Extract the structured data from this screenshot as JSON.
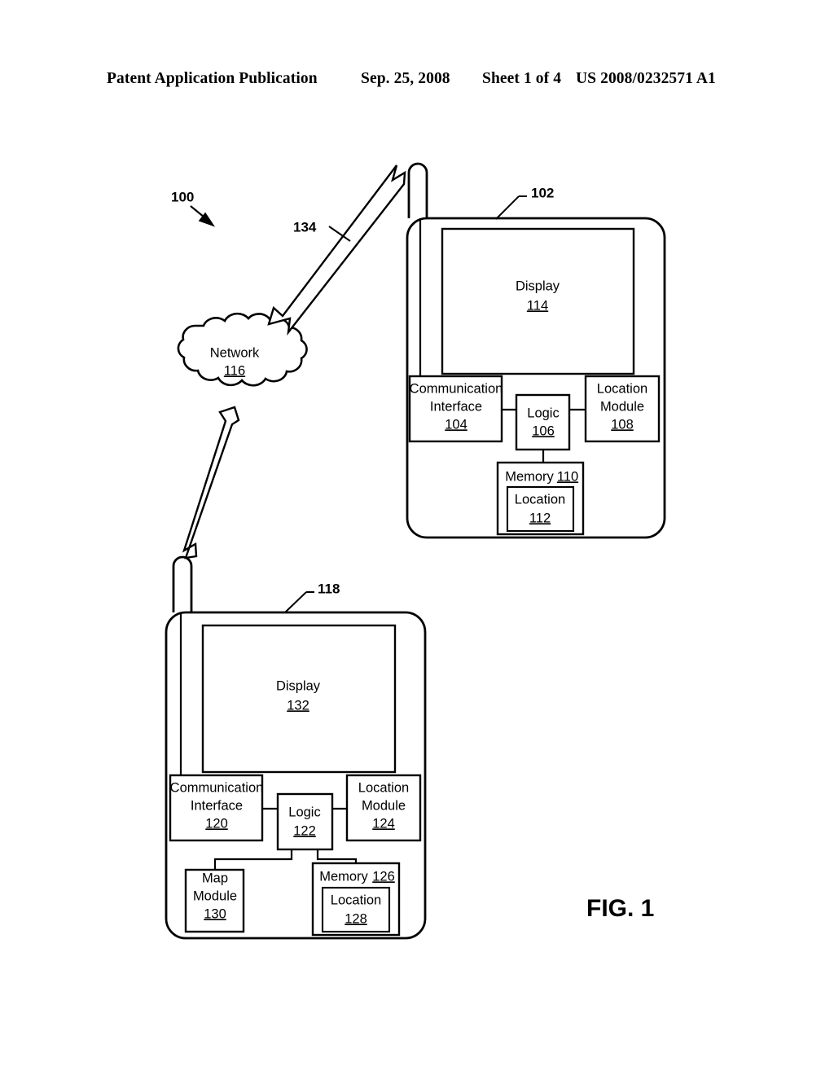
{
  "header": {
    "publication": "Patent Application Publication",
    "date": "Sep. 25, 2008",
    "sheet": "Sheet 1 of 4",
    "patent_number": "US 2008/0232571 A1"
  },
  "figure": {
    "label": "FIG. 1",
    "system_ref": "100",
    "link_ref": "134",
    "network": {
      "name": "Network",
      "ref": "116"
    },
    "device_top": {
      "ref": "102",
      "display": {
        "name": "Display",
        "ref": "114"
      },
      "communication_interface": {
        "line1": "Communication",
        "line2": "Interface",
        "ref": "104"
      },
      "logic": {
        "name": "Logic",
        "ref": "106"
      },
      "location_module": {
        "line1": "Location",
        "line2": "Module",
        "ref": "108"
      },
      "memory": {
        "name": "Memory",
        "ref": "110"
      },
      "memory_location": {
        "name": "Location",
        "ref": "112"
      }
    },
    "device_bottom": {
      "ref": "118",
      "display": {
        "name": "Display",
        "ref": "132"
      },
      "communication_interface": {
        "line1": "Communication",
        "line2": "Interface",
        "ref": "120"
      },
      "logic": {
        "name": "Logic",
        "ref": "122"
      },
      "location_module": {
        "line1": "Location",
        "line2": "Module",
        "ref": "124"
      },
      "map_module": {
        "line1": "Map",
        "line2": "Module",
        "ref": "130"
      },
      "memory": {
        "name": "Memory",
        "ref": "126"
      },
      "memory_location": {
        "name": "Location",
        "ref": "128"
      }
    }
  },
  "colors": {
    "ink": "#000000",
    "paper": "#ffffff"
  }
}
